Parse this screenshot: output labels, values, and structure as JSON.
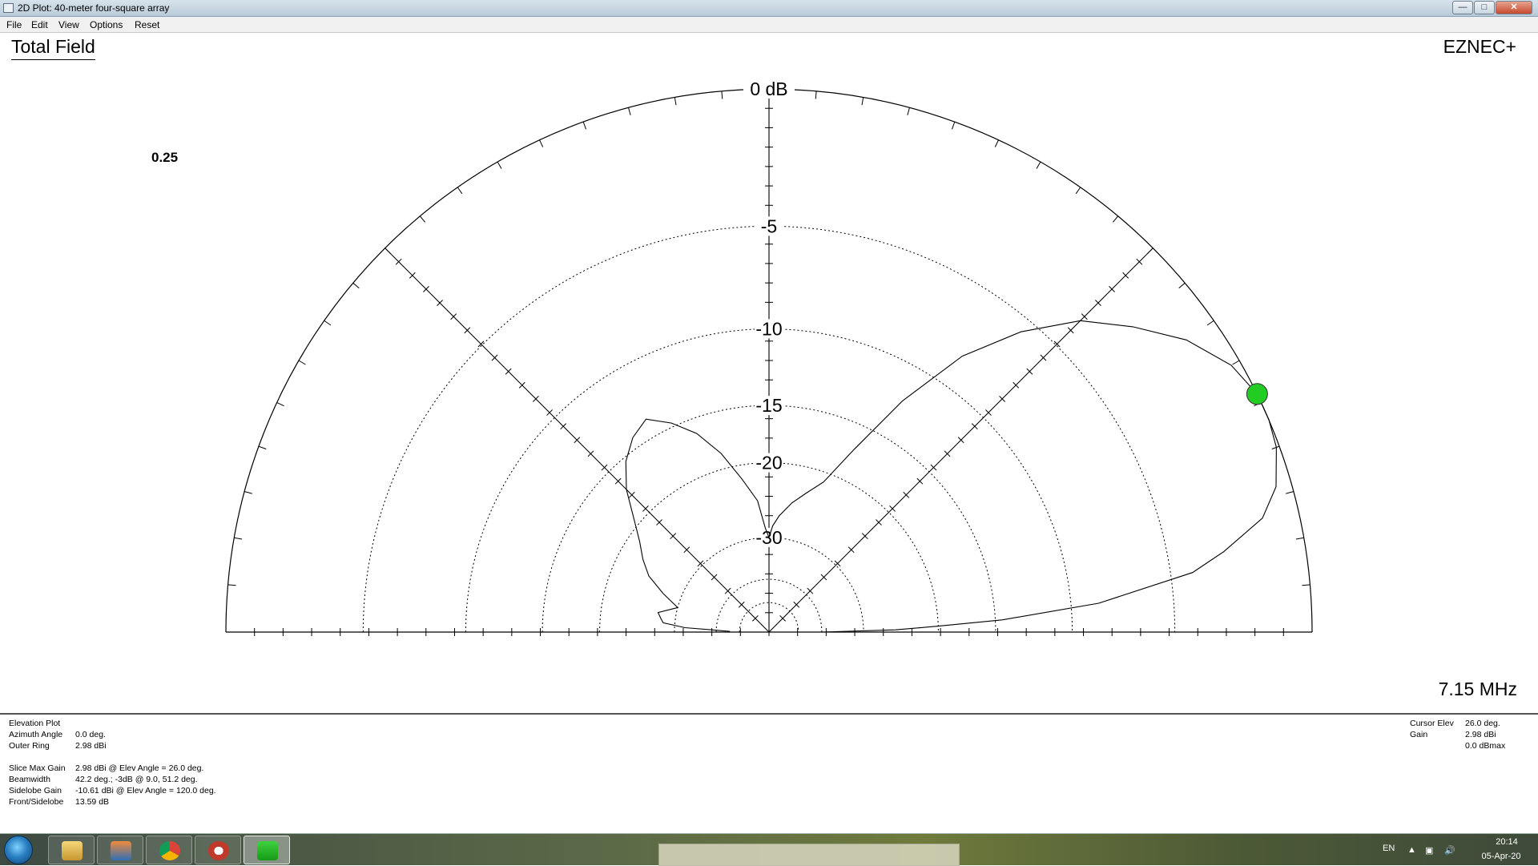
{
  "window": {
    "title": "2D Plot: 40-meter four-square array",
    "minimize": "—",
    "maximize": "□",
    "close": "✕"
  },
  "menu": [
    "File",
    "Edit",
    "View",
    "Options",
    "Reset"
  ],
  "plot": {
    "title": "Total Field",
    "brand": "EZNEC+",
    "scale_value": "0.25",
    "frequency": "7.15 MHz",
    "ring_labels": [
      "0 dB",
      "-5",
      "-10",
      "-15",
      "-20",
      "-30"
    ],
    "ring_db": [
      0,
      -5,
      -10,
      -15,
      -20,
      -30,
      -40,
      -50
    ],
    "cursor_color": "#22cc22",
    "cursor_elev_deg": 26.0
  },
  "chart_data": {
    "type": "polar-elevation",
    "unit": "dBmax",
    "series": [
      {
        "angle_deg": [
          0,
          1,
          2,
          3,
          5,
          8,
          10,
          13,
          16,
          20,
          23,
          26,
          30,
          35,
          40,
          45,
          50,
          55,
          60,
          65,
          70,
          75,
          80,
          85,
          88,
          90,
          92,
          95,
          100,
          105,
          110,
          115,
          120,
          125,
          130,
          135,
          140,
          145,
          150,
          155,
          160,
          165,
          170,
          173,
          175,
          177,
          178,
          179,
          180
        ],
        "gain_dbmax": [
          -40,
          -25,
          -20,
          -14.5,
          -8.5,
          -4.1,
          -2.8,
          -1.2,
          -0.5,
          -0.1,
          0,
          0,
          -0.3,
          -1.1,
          -2.3,
          -3.6,
          -5.6,
          -8.2,
          -12.2,
          -17,
          -21,
          -22.8,
          -24.4,
          -26.4,
          -28,
          -30,
          -28.4,
          -24.3,
          -21.5,
          -18.5,
          -16.2,
          -14.7,
          -13.6,
          -14.2,
          -15.3,
          -17,
          -19.3,
          -21.2,
          -22.6,
          -24.2,
          -27,
          -30,
          -27,
          -27.6,
          -28,
          -32,
          -40,
          -45,
          -45
        ]
      }
    ]
  },
  "info": {
    "rows": [
      {
        "key": "Elevation Plot",
        "val": ""
      },
      {
        "key": "Azimuth Angle",
        "val": "0.0 deg."
      },
      {
        "key": "Outer Ring",
        "val": "2.98 dBi"
      },
      {
        "key": "Slice Max Gain",
        "val": "2.98 dBi @ Elev Angle = 26.0 deg."
      },
      {
        "key": "Beamwidth",
        "val": "42.2 deg.; -3dB @ 9.0, 51.2 deg."
      },
      {
        "key": "Sidelobe Gain",
        "val": "-10.61 dBi @ Elev Angle = 120.0 deg."
      },
      {
        "key": "Front/Sidelobe",
        "val": "13.59 dB"
      }
    ],
    "cursor": [
      {
        "key": "Cursor Elev",
        "val": "26.0 deg."
      },
      {
        "key": "Gain",
        "val": "2.98 dBi"
      },
      {
        "key": "",
        "val": "0.0 dBmax"
      }
    ]
  },
  "taskbar": {
    "language": "EN",
    "time": "20:14",
    "date": "05-Apr-20",
    "apps": [
      "explorer",
      "network-app",
      "chrome",
      "globe-app",
      "eznec"
    ]
  }
}
